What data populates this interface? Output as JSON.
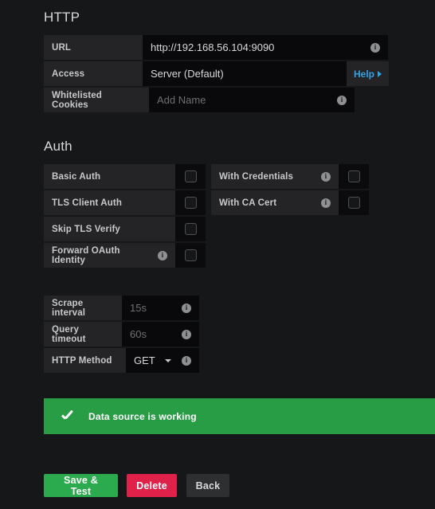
{
  "sections": {
    "http": {
      "title": "HTTP"
    },
    "auth": {
      "title": "Auth"
    }
  },
  "http_rows": {
    "url": {
      "label": "URL",
      "value": "http://192.168.56.104:9090",
      "info_icon": "info-icon"
    },
    "access": {
      "label": "Access",
      "value": "Server (Default)",
      "caret_icon": "chevron-down-icon"
    },
    "whitelisted_cookies": {
      "label": "Whitelisted Cookies",
      "placeholder": "Add Name",
      "value": "",
      "info_icon": "info-icon"
    }
  },
  "help_button": {
    "label": "Help",
    "arrow_icon": "chevron-right-icon",
    "color": "#33a2e5"
  },
  "auth_left": [
    {
      "label": "Basic Auth",
      "checked": false,
      "has_info": false
    },
    {
      "label": "TLS Client Auth",
      "checked": false,
      "has_info": false
    },
    {
      "label": "Skip TLS Verify",
      "checked": false,
      "has_info": false
    },
    {
      "label": "Forward OAuth Identity",
      "checked": false,
      "has_info": true
    }
  ],
  "auth_right": [
    {
      "label": "With Credentials",
      "checked": false,
      "has_info": true
    },
    {
      "label": "With CA Cert",
      "checked": false,
      "has_info": true
    }
  ],
  "settings_rows": {
    "scrape_interval": {
      "label": "Scrape interval",
      "placeholder": "15s",
      "value": ""
    },
    "query_timeout": {
      "label": "Query timeout",
      "placeholder": "60s",
      "value": ""
    },
    "http_method": {
      "label": "HTTP Method",
      "value": "GET"
    }
  },
  "status_banner": {
    "message": "Data source is working",
    "icon": "check-icon",
    "color": "#299c46"
  },
  "buttons": {
    "save": {
      "label": "Save & Test",
      "color": "#2bab4e"
    },
    "delete": {
      "label": "Delete",
      "color": "#e0224a"
    },
    "back": {
      "label": "Back",
      "color": "#2e2f31"
    }
  }
}
